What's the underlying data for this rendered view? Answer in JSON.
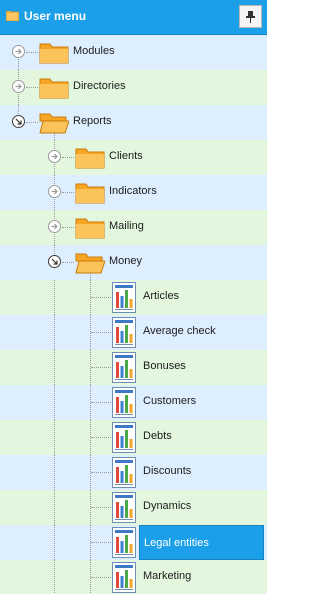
{
  "header": {
    "title": "User menu"
  },
  "tree": {
    "modules": "Modules",
    "directories": "Directories",
    "reports": "Reports",
    "clients": "Clients",
    "indicators": "Indicators",
    "mailing": "Mailing",
    "money": "Money",
    "money_reports": [
      "Articles",
      "Average check",
      "Bonuses",
      "Customers",
      "Debts",
      "Discounts",
      "Dynamics",
      "Legal entities",
      "Marketing"
    ],
    "selected": "Legal entities"
  },
  "colors": {
    "accent": "#1a9fe8",
    "row_blue": "#ddeeff",
    "row_green": "#e2f7dd"
  }
}
